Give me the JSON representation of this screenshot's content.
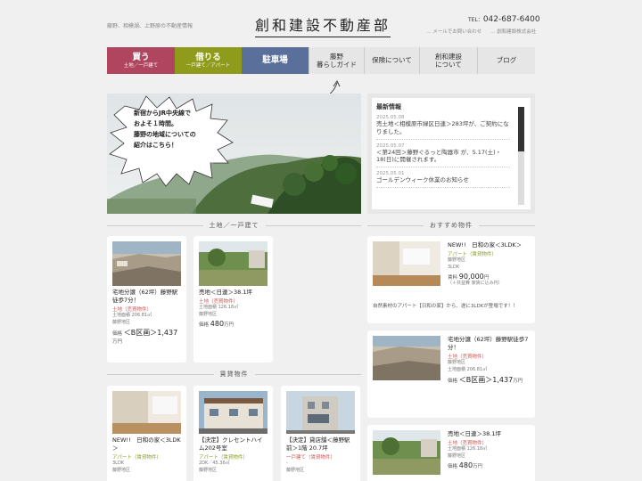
{
  "header": {
    "tagline": "藤野、相模湖、上野原の不動産情報",
    "logo": "創和建設不動産部",
    "tel_label": "TEL：",
    "tel": "042-687-6400",
    "links": [
      "… メールでお問い合わせ",
      "… 創和建設株式会社"
    ]
  },
  "nav": {
    "items": [
      {
        "main": "買う",
        "sub": "土地／一戸建て",
        "color": "#b04560"
      },
      {
        "main": "借りる",
        "sub": "一戸建て／アパート",
        "color": "#8e9b1b"
      },
      {
        "main": "駐車場",
        "sub": "",
        "color": "#5a709a"
      },
      {
        "label": "藤野\n暮らしガイド"
      },
      {
        "label": "保険について"
      },
      {
        "label": "創和建設\nについて"
      },
      {
        "label": "ブログ"
      }
    ]
  },
  "hero": {
    "bubble_lines": [
      "新宿からJR中央線で",
      "およそ１時間。",
      "藤野の地域についての",
      "紹介はこちら！"
    ]
  },
  "news": {
    "title": "最新情報",
    "items": [
      {
        "date": "2025.05.08",
        "text": "売土地＜相模原市緑区日連＞283坪が、ご契約になりました。"
      },
      {
        "date": "2025.05.07",
        "text": "＜第24回＞藤野ぐるっと陶器市 が、5.17(土)・18(日)に開催されます。"
      },
      {
        "date": "2025.05.01",
        "text": "ゴールデンウィーク休業のお知らせ"
      }
    ]
  },
  "sections": {
    "land": "土地／一戸建て",
    "recommend": "おすすめ物件",
    "rental": "賃貸物件"
  },
  "land_cards": [
    {
      "title": "宅地分譲（62坪）藤野駅徒歩7分！",
      "cat": "土地（売買物件）",
      "area": "土地面積 206.81㎡",
      "loc": "藤野地区",
      "price_label": "価格",
      "price": "＜B区画＞1,437",
      "unit": "万円"
    },
    {
      "title": "売地＜日連＞38.1坪",
      "cat": "土地（売買物件）",
      "area": "土地面積 126.18㎡",
      "loc": "藤野地区",
      "price_label": "価格",
      "price": "480",
      "unit": "万円"
    }
  ],
  "rental_cards": [
    {
      "title": "NEW!!　日和の家＜3LDK＞",
      "cat": "アパート（賃貸物件）",
      "sub1": "3LDK",
      "sub2": "藤野地区"
    },
    {
      "title": "【決定】クレセントハイム202号室",
      "cat": "アパート（賃貸物件）",
      "sub1": "2DK／45.36㎡",
      "sub2": "藤野地区"
    },
    {
      "title": "【決定】貸店舗＜藤野駅前＞1階 20.7坪",
      "cat": "一戸建て（賃貸物件）",
      "sub1": "-",
      "sub2": "藤野地区"
    }
  ],
  "rec_cards": [
    {
      "title": "NEW!!　日和の家＜3LDK＞",
      "cat": "アパート（賃貸物件）",
      "sub1": "藤野地区",
      "sub2": "3LDK",
      "price_label": "賃料",
      "price": "90,000",
      "unit": "円",
      "extra": "（＋共益費 家賃に込み円）",
      "note": "自然素材のアパート【日和の家】から、遂に3LDKが登場です！！"
    },
    {
      "title": "宅地分譲（62坪）藤野駅徒歩7分！",
      "cat": "土地（売買物件）",
      "sub1": "藤野地区",
      "sub2": "土地面積 206.81㎡",
      "price_label": "価格",
      "price": "＜B区画＞1,437",
      "unit": "万円"
    },
    {
      "title": "売地＜日連＞38.1坪",
      "cat": "土地（売買物件）",
      "sub1": "土地面積 126.18㎡",
      "sub2": "藤野地区",
      "price_label": "価格",
      "price": "480",
      "unit": "万円"
    }
  ]
}
